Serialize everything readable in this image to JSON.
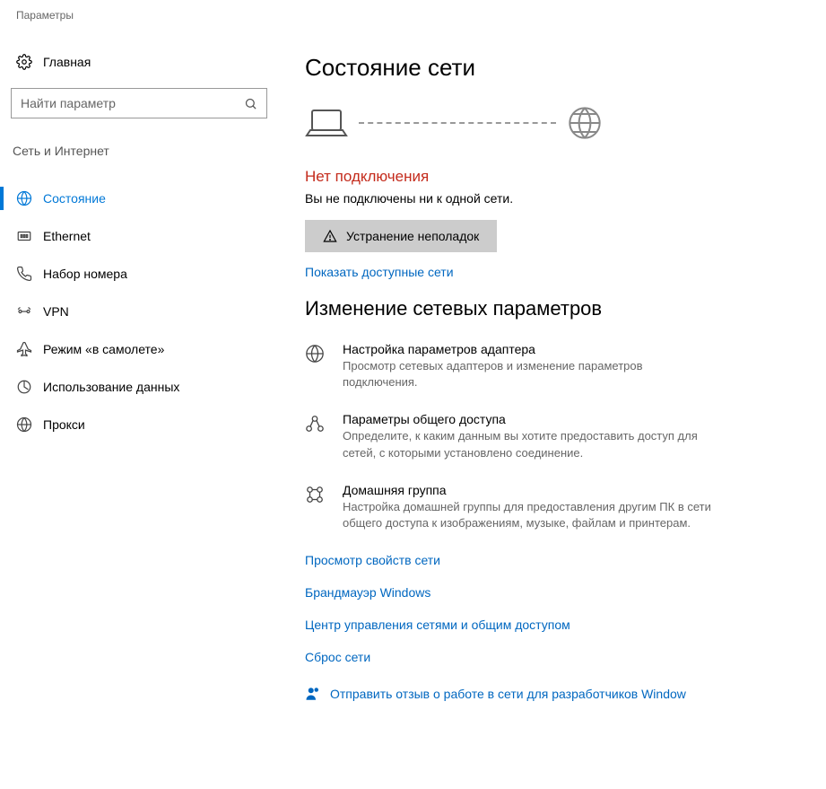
{
  "window": {
    "title": "Параметры"
  },
  "sidebar": {
    "home_label": "Главная",
    "search_placeholder": "Найти параметр",
    "section_title": "Сеть и Интернет",
    "items": [
      {
        "label": "Состояние"
      },
      {
        "label": "Ethernet"
      },
      {
        "label": "Набор номера"
      },
      {
        "label": "VPN"
      },
      {
        "label": "Режим «в самолете»"
      },
      {
        "label": "Использование данных"
      },
      {
        "label": "Прокси"
      }
    ]
  },
  "main": {
    "heading": "Состояние сети",
    "status_title": "Нет подключения",
    "status_desc": "Вы не подключены ни к одной сети.",
    "troubleshoot_label": "Устранение неполадок",
    "show_networks_link": "Показать доступные сети",
    "change_heading": "Изменение сетевых параметров",
    "rows": [
      {
        "title": "Настройка параметров адаптера",
        "desc": "Просмотр сетевых адаптеров и изменение параметров подключения."
      },
      {
        "title": "Параметры общего доступа",
        "desc": "Определите, к каким данным вы хотите предоставить доступ для сетей, с которыми установлено соединение."
      },
      {
        "title": "Домашняя группа",
        "desc": "Настройка домашней группы для предоставления другим ПК в сети общего доступа к изображениям, музыке, файлам и принтерам."
      }
    ],
    "links": [
      "Просмотр свойств сети",
      "Брандмауэр Windows",
      "Центр управления сетями и общим доступом",
      "Сброс сети"
    ],
    "feedback_label": "Отправить отзыв о работе в сети для разработчиков Window"
  }
}
